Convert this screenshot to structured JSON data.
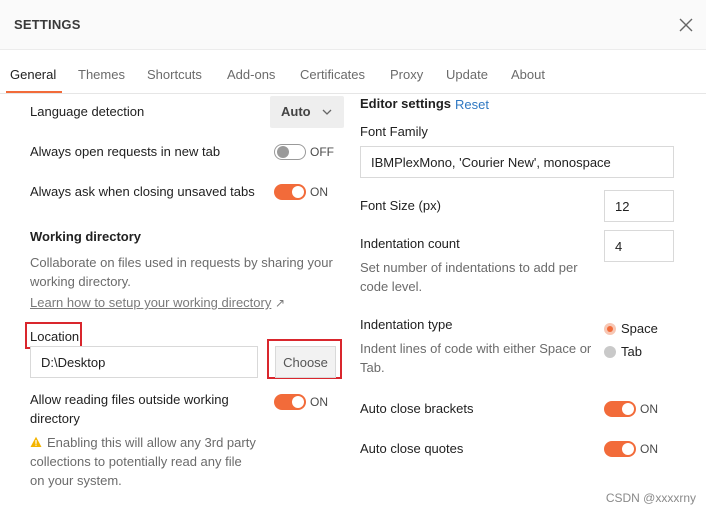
{
  "window": {
    "title": "SETTINGS"
  },
  "tabs": [
    {
      "label": "General",
      "active": true
    },
    {
      "label": "Themes"
    },
    {
      "label": "Shortcuts"
    },
    {
      "label": "Add-ons"
    },
    {
      "label": "Certificates"
    },
    {
      "label": "Proxy"
    },
    {
      "label": "Update"
    },
    {
      "label": "About"
    }
  ],
  "general": {
    "language_detection": {
      "label": "Language detection",
      "value": "Auto"
    },
    "open_in_new_tab": {
      "label": "Always open requests in new tab",
      "state": "OFF"
    },
    "ask_close_unsaved": {
      "label": "Always ask when closing unsaved tabs",
      "state": "ON"
    },
    "working_directory": {
      "heading": "Working directory",
      "desc_line1": "Collaborate on files used in requests by sharing your",
      "desc_line2": "working directory.",
      "learn_link": "Learn how to setup your working directory",
      "link_arrow": "↗",
      "location_label": "Location",
      "location_value": "D:\\Desktop",
      "choose_button": "Choose"
    },
    "allow_outside": {
      "label_line1": "Allow reading files outside working",
      "label_line2": "directory",
      "state": "ON",
      "warning_line1": "Enabling this will allow any 3rd party",
      "warning_line2": "collections to potentially read any file",
      "warning_line3": "on your system."
    }
  },
  "editor": {
    "heading": "Editor settings",
    "reset": "Reset",
    "font_family": {
      "label": "Font Family",
      "value": "IBMPlexMono, 'Courier New', monospace"
    },
    "font_size": {
      "label": "Font Size (px)",
      "value": "12"
    },
    "indentation_count": {
      "label": "Indentation count",
      "desc_line1": "Set number of indentations to add per",
      "desc_line2": "code level.",
      "value": "4"
    },
    "indentation_type": {
      "label": "Indentation type",
      "desc_line1": "Indent lines of code with either Space or",
      "desc_line2": "Tab.",
      "options": [
        "Space",
        "Tab"
      ],
      "selected": "Space"
    },
    "auto_close_brackets": {
      "label": "Auto close brackets",
      "state": "ON"
    },
    "auto_close_quotes": {
      "label": "Auto close quotes",
      "state": "ON"
    }
  },
  "watermark": "CSDN @xxxxrny",
  "colors": {
    "accent": "#f26b3a",
    "link_blue": "#2f78c2",
    "highlight_red": "#d9262d"
  }
}
